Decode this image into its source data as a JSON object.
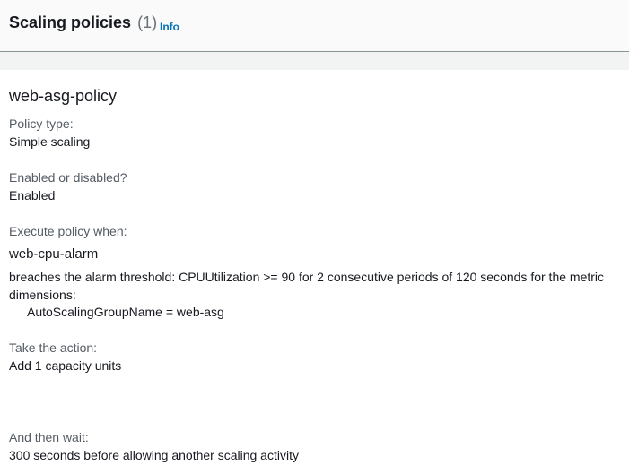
{
  "header": {
    "title": "Scaling policies",
    "count": "(1)",
    "info_label": "Info"
  },
  "policy": {
    "name": "web-asg-policy",
    "policy_type_label": "Policy type:",
    "policy_type_value": "Simple scaling",
    "enabled_label": "Enabled or disabled?",
    "enabled_value": "Enabled",
    "execute_label": "Execute policy when:",
    "alarm_name": "web-cpu-alarm",
    "breach_text": "breaches the alarm threshold: CPUUtilization >= 90 for 2 consecutive periods of 120 seconds for the metric dimensions:",
    "dimension": "AutoScalingGroupName = web-asg",
    "action_label": "Take the action:",
    "action_value": "Add 1 capacity units",
    "wait_label": "And then wait:",
    "wait_value": "300 seconds before allowing another scaling activity"
  }
}
